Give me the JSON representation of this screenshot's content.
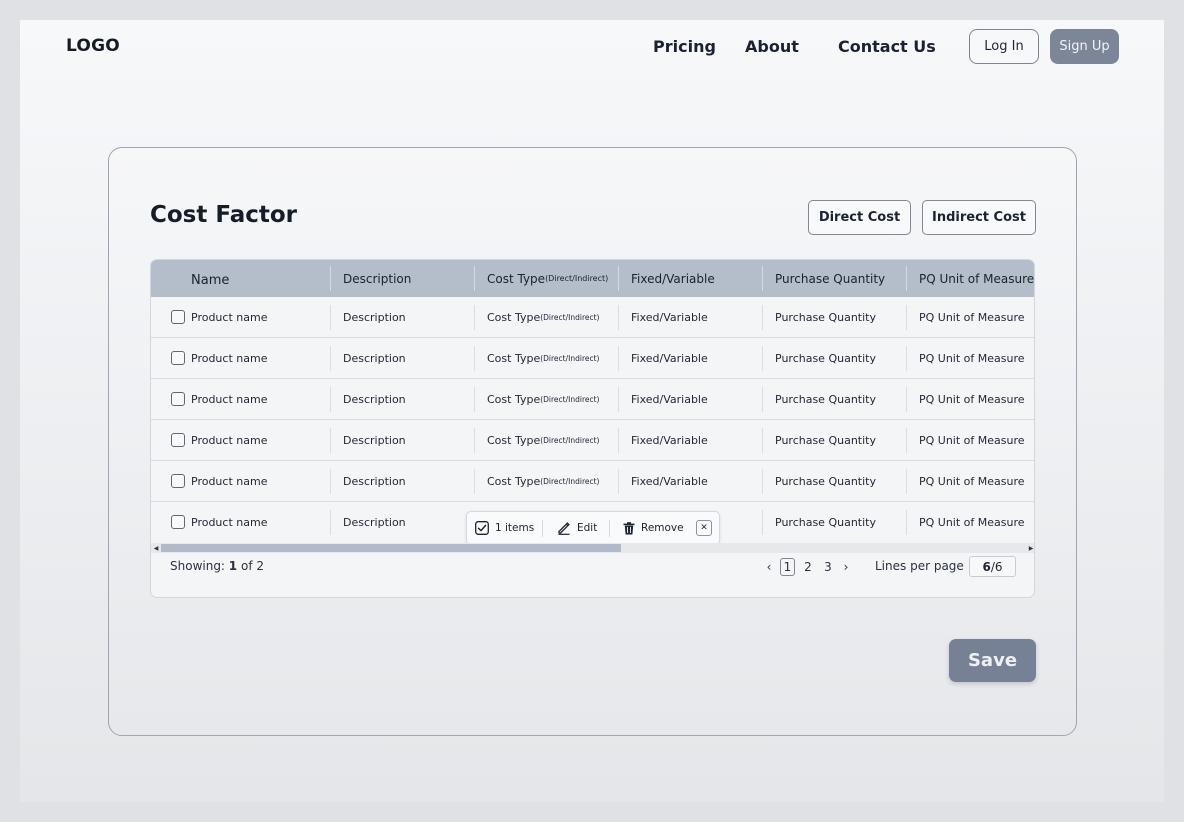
{
  "nav": {
    "logo": "LOGO",
    "links": [
      "Pricing",
      "About",
      "Contact Us"
    ],
    "login": "Log In",
    "signup": "Sign Up"
  },
  "page": {
    "title": "Cost Factor",
    "direct_cost": "Direct Cost",
    "indirect_cost": "Indirect Cost",
    "save": "Save"
  },
  "table": {
    "headers": {
      "name": "Name",
      "description": "Description",
      "cost_type": "Cost Type",
      "cost_type_sub": "(Direct/Indirect)",
      "fixed_variable": "Fixed/Variable",
      "purchase_quantity": "Purchase Quantity",
      "pq_unit": "PQ Unit of Measure"
    },
    "rows": [
      {
        "name": "Product name",
        "description": "Description",
        "cost_type": "Cost Type",
        "cost_type_sub": "(Direct/Indirect)",
        "fixed_variable": "Fixed/Variable",
        "purchase_quantity": "Purchase Quantity",
        "pq_unit": "PQ Unit of Measure"
      },
      {
        "name": "Product name",
        "description": "Description",
        "cost_type": "Cost Type",
        "cost_type_sub": "(Direct/Indirect)",
        "fixed_variable": "Fixed/Variable",
        "purchase_quantity": "Purchase Quantity",
        "pq_unit": "PQ Unit of Measure"
      },
      {
        "name": "Product name",
        "description": "Description",
        "cost_type": "Cost Type",
        "cost_type_sub": "(Direct/Indirect)",
        "fixed_variable": "Fixed/Variable",
        "purchase_quantity": "Purchase Quantity",
        "pq_unit": "PQ Unit of Measure"
      },
      {
        "name": "Product name",
        "description": "Description",
        "cost_type": "Cost Type",
        "cost_type_sub": "(Direct/Indirect)",
        "fixed_variable": "Fixed/Variable",
        "purchase_quantity": "Purchase Quantity",
        "pq_unit": "PQ Unit of Measure"
      },
      {
        "name": "Product name",
        "description": "Description",
        "cost_type": "Cost Type",
        "cost_type_sub": "(Direct/Indirect)",
        "fixed_variable": "Fixed/Variable",
        "purchase_quantity": "Purchase Quantity",
        "pq_unit": "PQ Unit of Measure"
      },
      {
        "name": "Product name",
        "description": "Description",
        "purchase_quantity": "Purchase Quantity",
        "pq_unit": "PQ Unit of Measure"
      }
    ],
    "action_bar": {
      "selected": "1 items",
      "edit": "Edit",
      "remove": "Remove",
      "close": "✕"
    },
    "footer": {
      "showing_prefix": "Showing: ",
      "showing_current": "1",
      "showing_suffix": " of 2",
      "prev": "‹",
      "pages": [
        "1",
        "2",
        "3"
      ],
      "next": "›",
      "lines_per_page_label": "Lines per page",
      "lines_current": "6",
      "lines_total": "/6"
    }
  },
  "icons": {
    "checkbox-checked": "check-square-icon",
    "edit": "pencil-icon",
    "remove": "trash-icon",
    "close": "close-icon"
  }
}
